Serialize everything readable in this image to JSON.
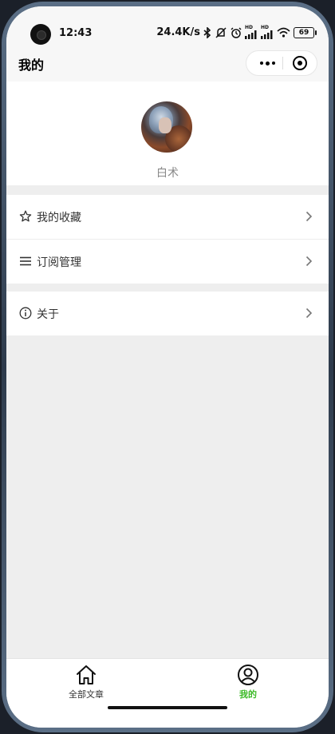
{
  "status_bar": {
    "time": "12:43",
    "network_speed": "24.4K/s",
    "icons": [
      "bluetooth-icon",
      "silent-icon",
      "alarm-icon",
      "signal-hd-icon",
      "signal-hd-icon",
      "wifi-icon"
    ],
    "hd_label": "HD",
    "battery": "69"
  },
  "nav": {
    "title": "我的"
  },
  "profile": {
    "username": "白术"
  },
  "menu": {
    "group1": [
      {
        "label": "我的收藏",
        "icon": "star-icon"
      },
      {
        "label": "订阅管理",
        "icon": "list-icon"
      }
    ],
    "group2": [
      {
        "label": "关于",
        "icon": "info-icon"
      }
    ]
  },
  "tabs": [
    {
      "label": "全部文章",
      "icon": "home-icon",
      "active": false
    },
    {
      "label": "我的",
      "icon": "user-icon",
      "active": true
    }
  ],
  "colors": {
    "accent": "#3cba27",
    "page_bg": "#eeeeee",
    "card_bg": "#ffffff"
  }
}
